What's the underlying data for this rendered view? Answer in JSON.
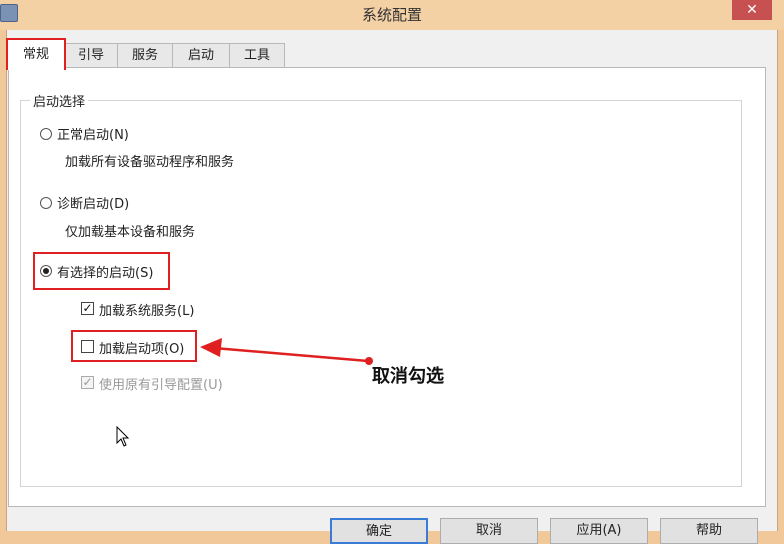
{
  "window": {
    "title": "系统配置",
    "close_label": "✕"
  },
  "tabs": [
    {
      "label": "常规",
      "active": true
    },
    {
      "label": "引导",
      "active": false
    },
    {
      "label": "服务",
      "active": false
    },
    {
      "label": "启动",
      "active": false
    },
    {
      "label": "工具",
      "active": false
    }
  ],
  "startup_selection": {
    "group_label": "启动选择",
    "normal": {
      "label": "正常启动(N)",
      "description": "加载所有设备驱动程序和服务",
      "selected": false
    },
    "diagnostic": {
      "label": "诊断启动(D)",
      "description": "仅加载基本设备和服务",
      "selected": false
    },
    "selective": {
      "label": "有选择的启动(S)",
      "selected": true,
      "load_system_services": {
        "label": "加载系统服务(L)",
        "checked": true,
        "enabled": true
      },
      "load_startup_items": {
        "label": "加载启动项(O)",
        "checked": false,
        "enabled": true
      },
      "use_original_boot": {
        "label": "使用原有引导配置(U)",
        "checked": true,
        "enabled": false
      }
    }
  },
  "annotation": {
    "text": "取消勾选",
    "color": "#e02020"
  },
  "buttons": {
    "ok": "确定",
    "cancel": "取消",
    "apply": "应用(A)",
    "help": "帮助"
  }
}
